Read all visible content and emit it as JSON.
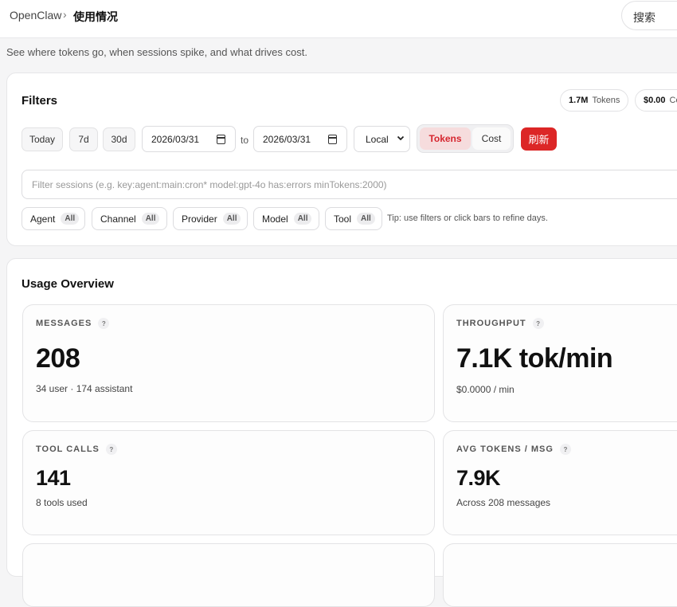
{
  "breadcrumb": {
    "root": "OpenClaw",
    "separator": "›",
    "current": "使用情况"
  },
  "search": {
    "placeholder": "搜索"
  },
  "page": {
    "subtitle": "See where tokens go, when sessions spike, and what drives cost."
  },
  "filters": {
    "title": "Filters",
    "summary": {
      "tokens_value": "1.7M",
      "tokens_label": "Tokens",
      "cost_value": "$0.00",
      "cost_label": "Co"
    },
    "range_buttons": [
      "Today",
      "7d",
      "30d"
    ],
    "date_from": "2026/03/31",
    "to_label": "to",
    "date_to": "2026/03/31",
    "timezone": "Local",
    "mode_options": [
      "Tokens",
      "Cost"
    ],
    "mode_selected": "Tokens",
    "refresh_label": "刷新",
    "query_placeholder": "Filter sessions (e.g. key:agent:main:cron* model:gpt-4o has:errors minTokens:2000)",
    "chips": [
      {
        "label": "Agent",
        "value": "All"
      },
      {
        "label": "Channel",
        "value": "All"
      },
      {
        "label": "Provider",
        "value": "All"
      },
      {
        "label": "Model",
        "value": "All"
      },
      {
        "label": "Tool",
        "value": "All"
      }
    ],
    "tip": "Tip: use filters or click bars to refine days."
  },
  "overview": {
    "title": "Usage Overview",
    "help_glyph": "?",
    "stats": [
      {
        "label": "MESSAGES",
        "value": "208",
        "sub": "34 user · 174 assistant"
      },
      {
        "label": "THROUGHPUT",
        "value": "7.1K tok/min",
        "sub": "$0.0000 / min"
      },
      {
        "label": "TOOL CALLS",
        "value": "141",
        "sub": "8 tools used"
      },
      {
        "label": "AVG TOKENS / MSG",
        "value": "7.9K",
        "sub": "Across 208 messages"
      }
    ]
  },
  "colors": {
    "accent": "#dc2626",
    "toggle_active_bg": "#f6dcdd",
    "page_bg": "#f5f5f6"
  }
}
